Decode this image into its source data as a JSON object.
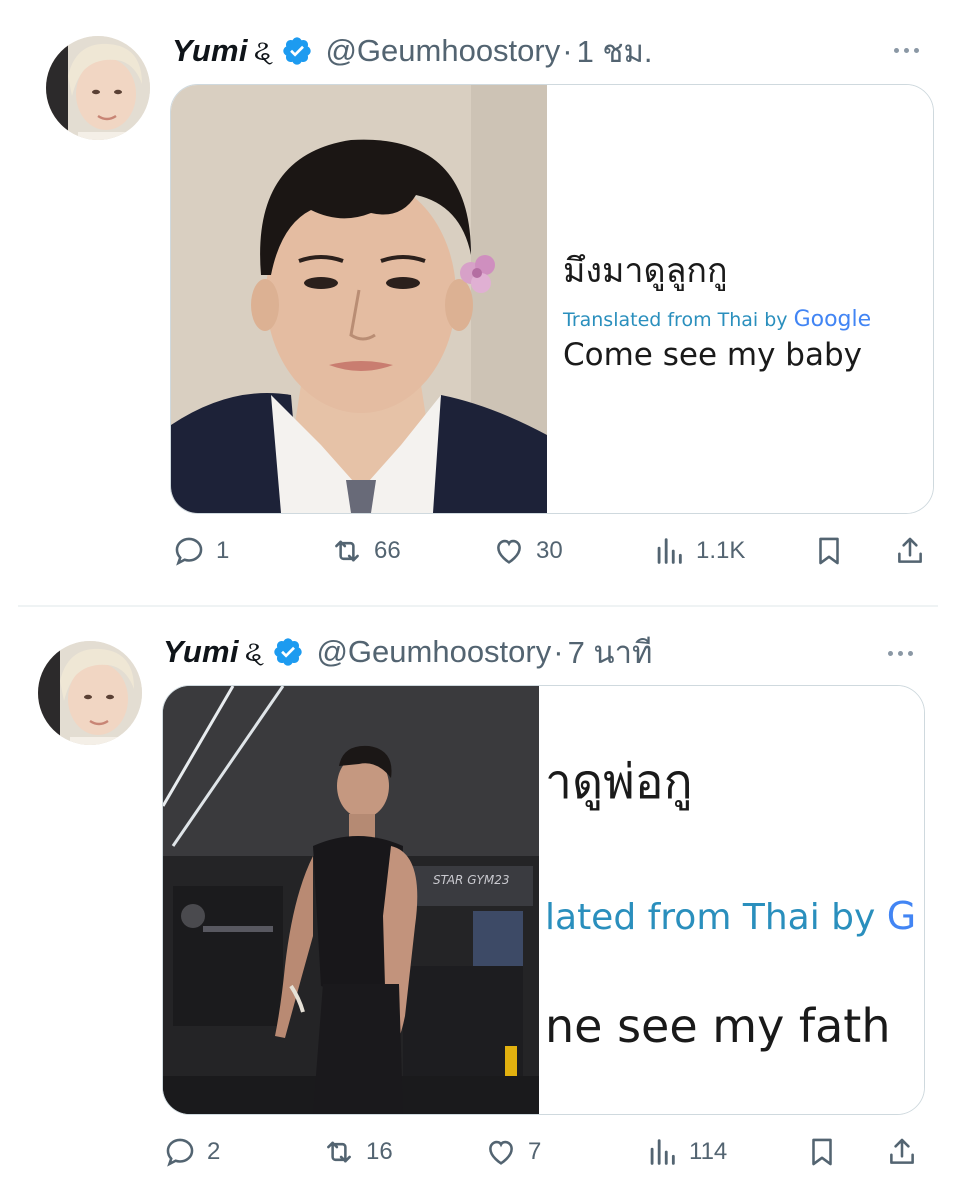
{
  "colors": {
    "verified": "#1d9bf0",
    "handle_gray": "#536471",
    "divider": "#eff3f4",
    "translate_blue": "#2a8fbd"
  },
  "tweets": [
    {
      "author": {
        "display_name": "Yumi",
        "name_glyph": "ୡ",
        "verified": true
      },
      "handle": "@Geumhoostory",
      "separator": "·",
      "timestamp": "1 ชม.",
      "media": {
        "thai_text": "มึงมาดูลูกกู",
        "translated_label": "Translated from Thai by",
        "google_label": "Google",
        "english_text": "Come see my baby"
      },
      "actions": {
        "replies": "1",
        "retweets": "66",
        "likes": "30",
        "views": "1.1K"
      },
      "icons": [
        "reply-icon",
        "retweet-icon",
        "like-icon",
        "views-icon",
        "bookmark-icon",
        "share-icon",
        "more-icon",
        "verified-icon"
      ]
    },
    {
      "author": {
        "display_name": "Yumi",
        "name_glyph": "ୡ",
        "verified": true
      },
      "handle": "@Geumhoostory",
      "separator": "·",
      "timestamp": "7 นาที",
      "media": {
        "thai_text": "าดูพ่อกู",
        "translated_label": "lated from Thai by",
        "google_label": "G",
        "english_text": "ne see my fath"
      },
      "actions": {
        "replies": "2",
        "retweets": "16",
        "likes": "7",
        "views": "114"
      },
      "icons": [
        "reply-icon",
        "retweet-icon",
        "like-icon",
        "views-icon",
        "bookmark-icon",
        "share-icon",
        "more-icon",
        "verified-icon"
      ]
    }
  ]
}
